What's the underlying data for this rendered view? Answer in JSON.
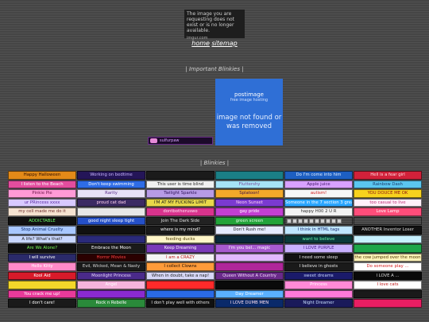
{
  "imgur": {
    "message": "The image you are requesting does not exist or is no longer available.",
    "domain": "imgur.com"
  },
  "nav": {
    "home": "home",
    "sitemap": "sitemap"
  },
  "important": {
    "title": "| Important Blinkies |",
    "postimage_brand": "postimage",
    "postimage_tag": "free image hosting",
    "postimage_error": "image not found or was removed",
    "blinkie": "sulfurpaw"
  },
  "blinkies": {
    "title": "| Blinkies |",
    "rows": [
      [
        {
          "t": "Happy Halloween",
          "bg": "#e38a18",
          "fg": "#2a0b00"
        },
        {
          "t": "Working on bedtime",
          "bg": "#241558",
          "fg": "#c9b6ff"
        },
        {
          "t": "",
          "bg": "#1b1b1b",
          "fg": "#f24a4a"
        },
        {
          "t": "",
          "bg": "#1a7f86",
          "fg": "#aef8ff"
        },
        {
          "t": "Do I'm come into him",
          "bg": "#1d5fc2",
          "fg": "#e8f2ff"
        },
        {
          "t": "Hell is a fear girl",
          "bg": "#d2213a",
          "fg": "#ffe0e6"
        }
      ],
      [
        {
          "t": "I listen to the Beach",
          "bg": "#e34d9e",
          "fg": "#fff"
        },
        {
          "t": "Don't keep swimming",
          "bg": "#2e6ce6",
          "fg": "#fff"
        },
        {
          "t": "This user is time blind",
          "bg": "#f0f0f0",
          "fg": "#222"
        },
        {
          "t": "Fluttershy",
          "bg": "#a6e3f7",
          "fg": "#7a4a9a"
        },
        {
          "t": "Apple juice",
          "bg": "#d8a1ff",
          "fg": "#3a1060"
        },
        {
          "t": "Rainbow Dash",
          "bg": "#5bc6ef",
          "fg": "#1a3a6a"
        }
      ],
      [
        {
          "t": "Pinkie Pie",
          "bg": "#ff9ad6",
          "fg": "#6b1246"
        },
        {
          "t": "Rarity",
          "bg": "#e7e1f7",
          "fg": "#5a2b8a"
        },
        {
          "t": "Twilight Sparkle",
          "bg": "#b79be6",
          "fg": "#2a0f55"
        },
        {
          "t": "Splatoon!",
          "bg": "#f2a92a",
          "fg": "#3a0b4a"
        },
        {
          "t": "autism!",
          "bg": "#f6f6f6",
          "fg": "#d01818"
        },
        {
          "t": "YOU DOUCE ME OK",
          "bg": "#f7d21e",
          "fg": "#8a1010"
        }
      ],
      [
        {
          "t": "ur PRincess xxxx",
          "bg": "#d8c9ff",
          "fg": "#5a2aa0"
        },
        {
          "t": "proud cat dad",
          "bg": "#3c2a63",
          "fg": "#ffd0f0"
        },
        {
          "t": "I'M AT MY FUCKING LIMIT",
          "bg": "#e8d84a",
          "fg": "#1a1a1a"
        },
        {
          "t": "Neon Sunset",
          "bg": "#7a3ad0",
          "fg": "#ffd2f6"
        },
        {
          "t": "Someone in the 7 section 3 great",
          "bg": "#2aa6ff",
          "fg": "#fff"
        },
        {
          "t": "too casual to live",
          "bg": "#fff0fa",
          "fg": "#c0307a"
        }
      ],
      [
        {
          "t": "my cell made me do it",
          "bg": "#f5e2d0",
          "fg": "#6b2a2a"
        },
        {
          "t": "",
          "bg": "#e7e7e7",
          "fg": "#333"
        },
        {
          "t": "dontbotheruswo",
          "bg": "#d9338d",
          "fg": "#ffe5f4"
        },
        {
          "t": "gay pride",
          "bg": "#c23fd1",
          "fg": "#fff"
        },
        {
          "t": "happy H00 2 U R",
          "bg": "#f2f2f2",
          "fg": "#333"
        },
        {
          "t": "Love Lamp",
          "bg": "#ff4d7a",
          "fg": "#fff"
        }
      ],
      [
        {
          "t": "ADDICTABLE",
          "bg": "#111",
          "fg": "#6bff6b"
        },
        {
          "t": "good night sleep tight",
          "bg": "#2550c8",
          "fg": "#fff"
        },
        {
          "t": "Join The Dark Side",
          "bg": "#222",
          "fg": "#e1e1e1"
        },
        {
          "t": "green screen",
          "bg": "#23a33a",
          "fg": "#eaffea"
        },
        {
          "t": "__DOTS__",
          "bg": "transparent",
          "fg": "#cfcfcf"
        },
        {
          "t": "",
          "bg": "transparent",
          "fg": "#cfcfcf"
        }
      ],
      [
        {
          "t": "Stop Animal Cruelty",
          "bg": "#a8c7ff",
          "fg": "#0a2a6a"
        },
        {
          "t": "",
          "bg": "#111",
          "fg": "#fff"
        },
        {
          "t": "where is my mind?",
          "bg": "#1a1a1a",
          "fg": "#fff"
        },
        {
          "t": "Don't Rush me!",
          "bg": "#e6eaff",
          "fg": "#222"
        },
        {
          "t": "I think in HTML tags",
          "bg": "#bfe6ff",
          "fg": "#1a2a6a"
        },
        {
          "t": "ANOTHER Inventor Loser",
          "bg": "#111",
          "fg": "#dcdcdc"
        }
      ],
      [
        {
          "t": "A life? What's that?",
          "bg": "#c9d7ff",
          "fg": "#222"
        },
        {
          "t": "",
          "bg": "#2a2a7a",
          "fg": "#fff"
        },
        {
          "t": "feeding ducks",
          "bg": "#fff6c8",
          "fg": "#4a3a00"
        },
        {
          "t": "",
          "bg": "#0a2a3a",
          "fg": "#fff"
        },
        {
          "t": "want to believe",
          "bg": "#0a3a3a",
          "fg": "#6bffb0"
        },
        {
          "t": "",
          "bg": "#c7f1ff",
          "fg": "#1a3a6a"
        }
      ],
      [
        {
          "t": "Are We Alone?",
          "bg": "#101010",
          "fg": "#7aff5a"
        },
        {
          "t": "Embrace the Moon",
          "bg": "#1a1a1a",
          "fg": "#ffffff"
        },
        {
          "t": "Keep Dreaming",
          "bg": "#7a3ab8",
          "fg": "#fff"
        },
        {
          "t": "I'm you bel... magic",
          "bg": "#a85ad0",
          "fg": "#fff"
        },
        {
          "t": "I LOVE PURPLE",
          "bg": "#c9b1ff",
          "fg": "#4a1a8a"
        },
        {
          "t": "",
          "bg": "#1ea64a",
          "fg": "#fff"
        }
      ],
      [
        {
          "t": "I will survive",
          "bg": "#2a2a6a",
          "fg": "#fff"
        },
        {
          "t": "Horror Movies",
          "bg": "#2a0000",
          "fg": "#ff4040"
        },
        {
          "t": "I am a CRAZY",
          "bg": "#f4f4f4",
          "fg": "#c01818"
        },
        {
          "t": "",
          "bg": "#e2b8ff",
          "fg": "#4a1a6a"
        },
        {
          "t": "I need some sleep",
          "bg": "#111",
          "fg": "#e7e7e7"
        },
        {
          "t": "the cow jumped over the moon",
          "bg": "#fff3b8",
          "fg": "#4a3a00"
        }
      ],
      [
        {
          "t": "Hello Kitty",
          "bg": "#ff8ac8",
          "fg": "#fff"
        },
        {
          "t": "Evil, Wicked, Mean & Nasty",
          "bg": "#1a1a1a",
          "fg": "#d8d8d8"
        },
        {
          "t": "I collect Clowns",
          "bg": "#ff9b3a",
          "fg": "#1a0a00"
        },
        {
          "t": "",
          "bg": "#b0269a",
          "fg": "#fff"
        },
        {
          "t": "I believe in ghosts",
          "bg": "#1a1a1a",
          "fg": "#e7e7e7"
        },
        {
          "t": "Do someone play ...",
          "bg": "#fff",
          "fg": "#d41a1a"
        }
      ],
      [
        {
          "t": "Kool Aid",
          "bg": "#d81a2a",
          "fg": "#fff"
        },
        {
          "t": "Moonlight Princess",
          "bg": "#4a2a8a",
          "fg": "#e8d8ff"
        },
        {
          "t": "When in doubt, take a nap!",
          "bg": "#d6d6f6",
          "fg": "#222"
        },
        {
          "t": "Queen Without A Country",
          "bg": "#6a2a8a",
          "fg": "#f6e0ff"
        },
        {
          "t": "sweet dreams",
          "bg": "#1a1a6a",
          "fg": "#c8d8ff"
        },
        {
          "t": "I LOVE A ...",
          "bg": "#0a0a0a",
          "fg": "#d8d8d8"
        }
      ],
      [
        {
          "t": "",
          "bg": "#f2d62a",
          "fg": "#1a1a1a"
        },
        {
          "t": "Angel",
          "bg": "#f6b4dc",
          "fg": "#fff"
        },
        {
          "t": "",
          "bg": "#ff2a2a",
          "fg": "#fff"
        },
        {
          "t": "",
          "bg": "#0a0a0a",
          "fg": "#fff"
        },
        {
          "t": "Princess",
          "bg": "#ff8ad6",
          "fg": "#fff"
        },
        {
          "t": "I love cats",
          "bg": "#fff",
          "fg": "#c01818"
        }
      ],
      [
        {
          "t": "You crack me up!",
          "bg": "#e83a9a",
          "fg": "#fff"
        },
        {
          "t": "",
          "bg": "#8a2ad0",
          "fg": "#fff"
        },
        {
          "t": "",
          "bg": "#2a6ae6",
          "fg": "#fff"
        },
        {
          "t": "Day Dreamer",
          "bg": "#5ab0ff",
          "fg": "#fff"
        },
        {
          "t": "",
          "bg": "#ff7ad8",
          "fg": "#fff"
        },
        {
          "t": "",
          "bg": "#1a1a1a",
          "fg": "#e7e7e7"
        }
      ],
      [
        {
          "t": "I don't care!",
          "bg": "#1a1a1a",
          "fg": "#fff"
        },
        {
          "t": "Rock n Rebelle",
          "bg": "#2a8a3a",
          "fg": "#fff"
        },
        {
          "t": "I don't play well with others",
          "bg": "#111",
          "fg": "#e8e8e8"
        },
        {
          "t": "I LOVE DUMB MEN",
          "bg": "#0a2a6a",
          "fg": "#ffe0f0"
        },
        {
          "t": "Night Dreamer",
          "bg": "#1a1a5a",
          "fg": "#c8e0ff"
        },
        {
          "t": "",
          "bg": "#e91e63",
          "fg": "#fff"
        }
      ]
    ]
  }
}
